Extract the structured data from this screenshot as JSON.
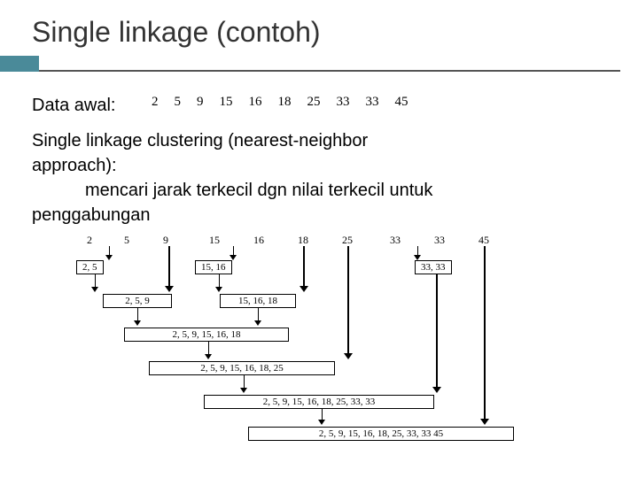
{
  "title": "Single linkage (contoh)",
  "data_label": "Data awal:",
  "data_values": [
    "2",
    "5",
    "9",
    "15",
    "16",
    "18",
    "25",
    "33",
    "33",
    "45"
  ],
  "para2_line1": "Single linkage clustering  (nearest-neighbor",
  "para2_line2": "approach):",
  "para2_line3": "mencari jarak terkecil dgn nilai terkecil untuk",
  "para2_line4": "penggabungan",
  "dendro": {
    "top": [
      "2",
      "5",
      "9",
      "15",
      "16",
      "18",
      "25",
      "33",
      "33",
      "45"
    ],
    "l1a": "2, 5",
    "l1b": "15, 16",
    "l1c": "33, 33",
    "l2a": "2, 5, 9",
    "l2b": "15, 16, 18",
    "l3": "2, 5, 9, 15, 16, 18",
    "l4": "2, 5, 9, 15, 16, 18, 25",
    "l5": "2, 5, 9, 15, 16, 18, 25, 33, 33",
    "l6": "2, 5, 9, 15, 16, 18, 25, 33, 33 45"
  }
}
